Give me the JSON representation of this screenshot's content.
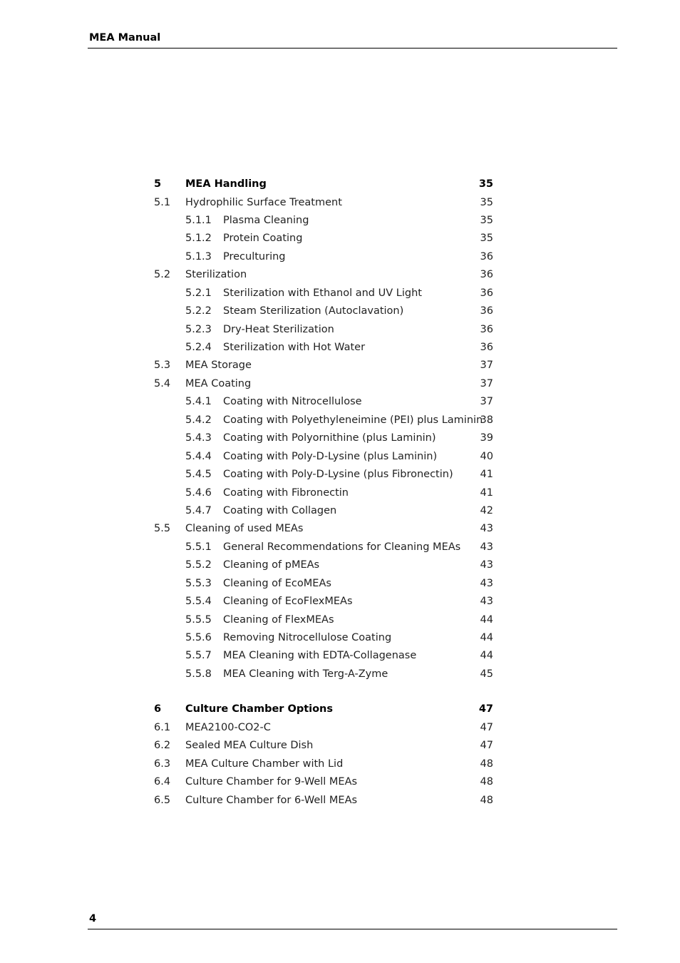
{
  "header": {
    "title": "MEA Manual"
  },
  "footer": {
    "page_number": "4"
  },
  "toc": [
    {
      "level": 1,
      "num": "5",
      "title": "MEA Handling",
      "page": "35"
    },
    {
      "level": 2,
      "num": "5.1",
      "title": "Hydrophilic Surface Treatment",
      "page": "35"
    },
    {
      "level": 3,
      "num": "5.1.1",
      "title": "Plasma Cleaning",
      "page": "35"
    },
    {
      "level": 3,
      "num": "5.1.2",
      "title": "Protein Coating",
      "page": "35"
    },
    {
      "level": 3,
      "num": "5.1.3",
      "title": "Preculturing",
      "page": "36"
    },
    {
      "level": 2,
      "num": "5.2",
      "title": "Sterilization",
      "page": "36"
    },
    {
      "level": 3,
      "num": "5.2.1",
      "title": "Sterilization with Ethanol and UV Light",
      "page": "36"
    },
    {
      "level": 3,
      "num": "5.2.2",
      "title": "Steam Sterilization (Autoclavation)",
      "page": "36"
    },
    {
      "level": 3,
      "num": "5.2.3",
      "title": "Dry-Heat Sterilization",
      "page": "36"
    },
    {
      "level": 3,
      "num": "5.2.4",
      "title": "Sterilization with Hot Water",
      "page": "36"
    },
    {
      "level": 2,
      "num": "5.3",
      "title": "MEA Storage",
      "page": "37"
    },
    {
      "level": 2,
      "num": "5.4",
      "title": "MEA Coating",
      "page": "37"
    },
    {
      "level": 3,
      "num": "5.4.1",
      "title": "Coating with Nitrocellulose",
      "page": "37"
    },
    {
      "level": 3,
      "num": "5.4.2",
      "title": "Coating with Polyethyleneimine (PEI) plus Laminin",
      "page": "38"
    },
    {
      "level": 3,
      "num": "5.4.3",
      "title": "Coating with Polyornithine (plus Laminin)",
      "page": "39"
    },
    {
      "level": 3,
      "num": "5.4.4",
      "title": "Coating with Poly-D-Lysine (plus Laminin)",
      "page": "40"
    },
    {
      "level": 3,
      "num": "5.4.5",
      "title": "Coating with Poly-D-Lysine (plus Fibronectin)",
      "page": "41"
    },
    {
      "level": 3,
      "num": "5.4.6",
      "title": "Coating with Fibronectin",
      "page": "41"
    },
    {
      "level": 3,
      "num": "5.4.7",
      "title": "Coating with Collagen",
      "page": "42"
    },
    {
      "level": 2,
      "num": "5.5",
      "title": "Cleaning of used MEAs",
      "page": "43"
    },
    {
      "level": 3,
      "num": "5.5.1",
      "title": "General Recommendations for Cleaning MEAs",
      "page": "43"
    },
    {
      "level": 3,
      "num": "5.5.2",
      "title": "Cleaning of pMEAs",
      "page": "43"
    },
    {
      "level": 3,
      "num": "5.5.3",
      "title": "Cleaning of EcoMEAs",
      "page": "43"
    },
    {
      "level": 3,
      "num": "5.5.4",
      "title": "Cleaning of EcoFlexMEAs",
      "page": "43"
    },
    {
      "level": 3,
      "num": "5.5.5",
      "title": "Cleaning of FlexMEAs",
      "page": "44"
    },
    {
      "level": 3,
      "num": "5.5.6",
      "title": "Removing Nitrocellulose Coating",
      "page": "44"
    },
    {
      "level": 3,
      "num": "5.5.7",
      "title": "MEA Cleaning with EDTA-Collagenase",
      "page": "44"
    },
    {
      "level": 3,
      "num": "5.5.8",
      "title": "MEA Cleaning with Terg-A-Zyme",
      "page": "45"
    },
    {
      "level": 1,
      "num": "6",
      "title": "Culture Chamber Options",
      "page": "47"
    },
    {
      "level": 2,
      "num": "6.1",
      "title": "MEA2100-CO2-C",
      "page": "47"
    },
    {
      "level": 2,
      "num": "6.2",
      "title": "Sealed MEA Culture Dish",
      "page": "47"
    },
    {
      "level": 2,
      "num": "6.3",
      "title": "MEA Culture Chamber with Lid",
      "page": "48"
    },
    {
      "level": 2,
      "num": "6.4",
      "title": "Culture Chamber for 9-Well MEAs",
      "page": "48"
    },
    {
      "level": 2,
      "num": "6.5",
      "title": "Culture Chamber for 6-Well MEAs",
      "page": "48"
    }
  ]
}
